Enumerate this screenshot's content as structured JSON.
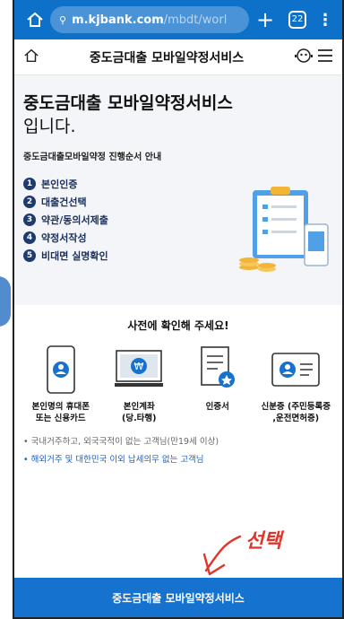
{
  "browser": {
    "url_domain": "m.kjbank.com",
    "url_path": "/mbdt/worl",
    "tab_count": "22"
  },
  "header": {
    "title": "중도금대출 모바일약정서비스"
  },
  "hero": {
    "title_line1": "중도금대출 모바일약정서비스",
    "title_line2": "입니다.",
    "guide": "중도금대출모바일약정 진행순서 안내",
    "steps": [
      {
        "num": "1",
        "label": "본인인증"
      },
      {
        "num": "2",
        "label": "대출건선택"
      },
      {
        "num": "3",
        "label": "약관/동의서제출"
      },
      {
        "num": "4",
        "label": "약정서작성"
      },
      {
        "num": "5",
        "label": "비대면 실명확인"
      }
    ]
  },
  "prereq": {
    "title": "사전에 확인해 주세요!",
    "items": [
      {
        "line1": "본인명의 휴대폰",
        "line2": "또는 신용카드"
      },
      {
        "line1": "본인계좌",
        "line2": "(당.타행)"
      },
      {
        "line1": "인증서",
        "line2": ""
      },
      {
        "line1": "신분증 (주민등록증",
        "line2": ",운전면허증)"
      }
    ],
    "note1": "• 국내거주하고, 외국국적이 없는 고객님(만19세 이상)",
    "note2": "• 해외거주 및 대한민국 이외 납세의무 없는 고객님"
  },
  "annotation": "선택",
  "cta_label": "중도금대출 모바일약정서비스",
  "colors": {
    "brand_blue": "#0d71c9",
    "button_blue": "#1573cf",
    "step_navy": "#1f3a6d",
    "annotation_red": "#e0342c"
  }
}
